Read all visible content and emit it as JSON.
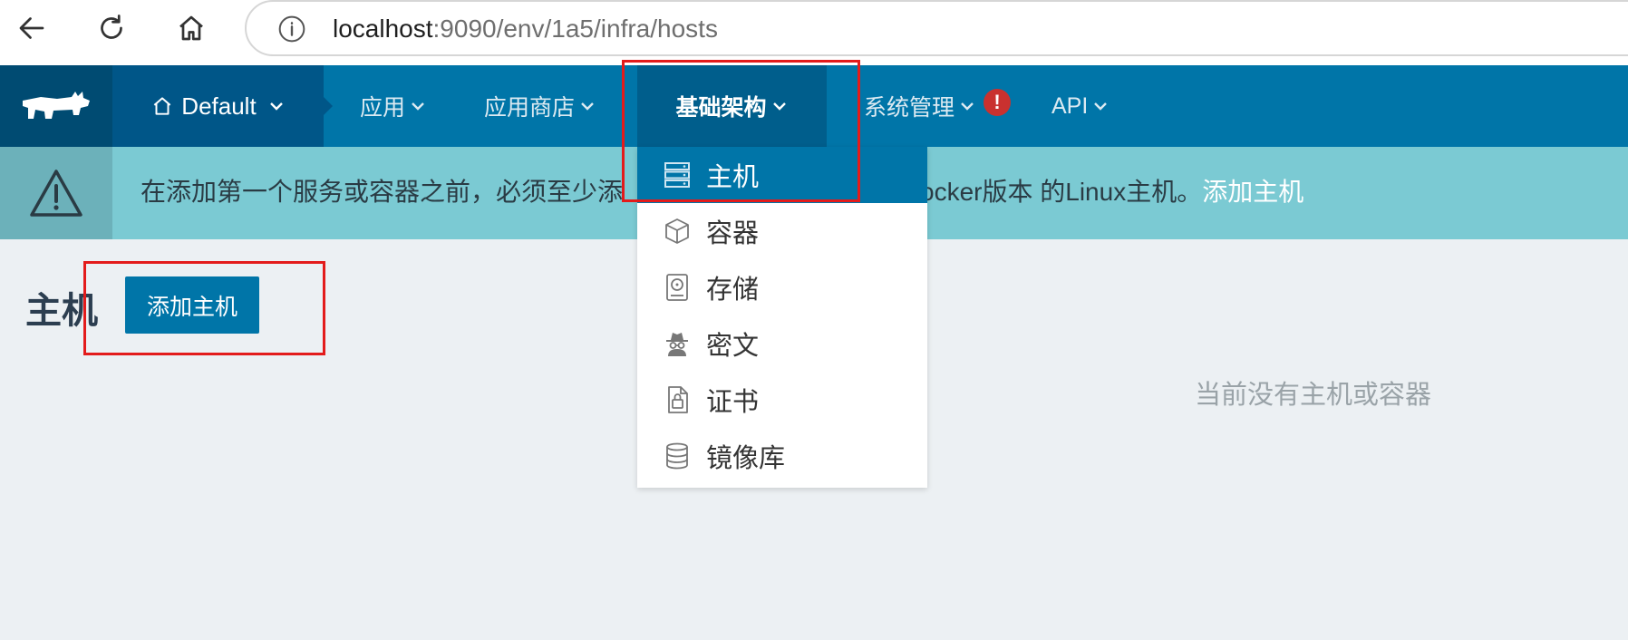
{
  "browser": {
    "url_host": "localhost",
    "url_rest": ":9090/env/1a5/infra/hosts"
  },
  "header": {
    "environment": "Default",
    "menu": [
      {
        "label": "应用"
      },
      {
        "label": "应用商店"
      },
      {
        "label": "基础架构"
      },
      {
        "label": "系统管理"
      },
      {
        "label": "API"
      }
    ],
    "alert_badge": "!"
  },
  "banner": {
    "text_before": "在添加第一个服务或容器之前，必须至少添",
    "text_hidden": "加一个运行支持的Docker版本",
    "text_visible_tail": "ocker版本 的Linux主机。",
    "link": "添加主机"
  },
  "page": {
    "title": "主机",
    "add_button": "添加主机",
    "empty_message": "当前没有主机或容器"
  },
  "dropdown": {
    "items": [
      {
        "label": "主机",
        "icon": "server-icon"
      },
      {
        "label": "容器",
        "icon": "cube-icon"
      },
      {
        "label": "存储",
        "icon": "hard-drive-icon"
      },
      {
        "label": "密文",
        "icon": "spy-icon"
      },
      {
        "label": "证书",
        "icon": "certificate-icon"
      },
      {
        "label": "镜像库",
        "icon": "database-icon"
      }
    ]
  },
  "colors": {
    "header": "#0075a8",
    "logo_bg": "#004b72",
    "banner": "#7bcad3",
    "page_bg": "#ecf0f3",
    "highlight": "#e31b1b"
  }
}
